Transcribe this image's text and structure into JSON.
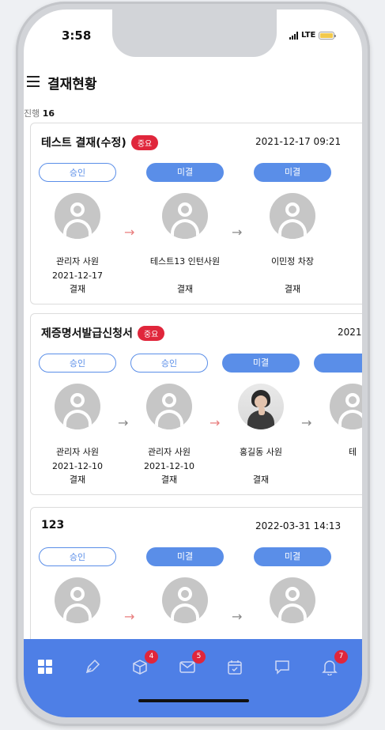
{
  "status_bar": {
    "time": "3:58",
    "network": "LTE"
  },
  "header": {
    "title": "결재현황"
  },
  "summary": {
    "label": "진행",
    "count": "16"
  },
  "colors": {
    "accent": "#5a8ee8",
    "nav": "#4e7fe6",
    "badge": "#e0263b"
  },
  "cards": [
    {
      "title": "테스트 결재(수정)",
      "badge": "중요",
      "date": "2021-12-17 09:21",
      "approvers": [
        {
          "status": "승인",
          "name": "관리자 사원",
          "date": "2021-12-17",
          "action": "결재"
        },
        {
          "status": "미결",
          "name": "테스트13 인턴사원",
          "date": "",
          "action": "결재"
        },
        {
          "status": "미결",
          "name": "이민정 차장",
          "date": "",
          "action": "결재"
        }
      ]
    },
    {
      "title": "제증명서발급신청서",
      "badge": "중요",
      "date": "2021",
      "approvers": [
        {
          "status": "승인",
          "name": "관리자 사원",
          "date": "2021-12-10",
          "action": "결재"
        },
        {
          "status": "승인",
          "name": "관리자 사원",
          "date": "2021-12-10",
          "action": "결재"
        },
        {
          "status": "미결",
          "name": "홍길동 사원",
          "date": "",
          "action": "결재"
        },
        {
          "status": "",
          "name": "테",
          "date": "",
          "action": ""
        }
      ]
    },
    {
      "title": "123",
      "badge": "",
      "date": "2022-03-31 14:13",
      "approvers": [
        {
          "status": "승인"
        },
        {
          "status": "미결"
        },
        {
          "status": "미결"
        }
      ]
    }
  ],
  "nav": {
    "items": [
      {
        "icon": "dashboard-icon",
        "badge": ""
      },
      {
        "icon": "pen-icon",
        "badge": ""
      },
      {
        "icon": "box-icon",
        "badge": "4"
      },
      {
        "icon": "mail-icon",
        "badge": "5"
      },
      {
        "icon": "calendar-icon",
        "badge": ""
      },
      {
        "icon": "chat-icon",
        "badge": ""
      },
      {
        "icon": "bell-icon",
        "badge": "7"
      }
    ]
  }
}
